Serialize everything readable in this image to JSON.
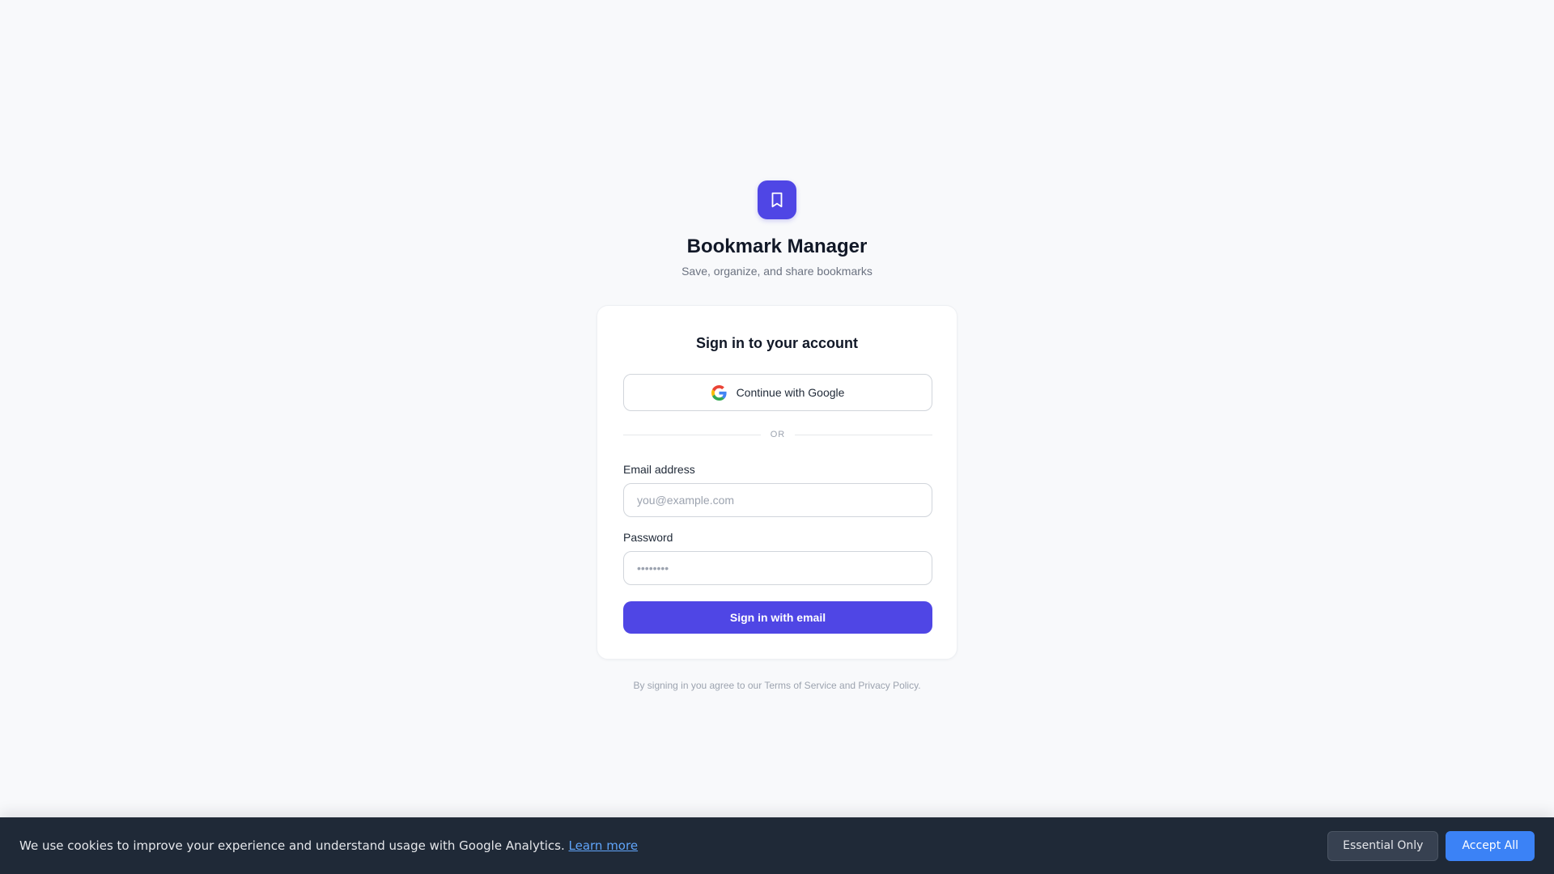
{
  "brand": {
    "logo_icon": "bookmark-icon",
    "accent_color": "#4f46e5",
    "title": "Bookmark Manager",
    "subtitle": "Save, organize, and share bookmarks"
  },
  "signin_card": {
    "title": "Sign in to your account",
    "google_button": {
      "label": "Continue with Google",
      "icon": "google-icon"
    },
    "divider_text": "OR",
    "email": {
      "label": "Email address",
      "placeholder": "you@example.com",
      "value": ""
    },
    "password": {
      "label": "Password",
      "placeholder": "••••••••",
      "value": ""
    },
    "submit_label": "Sign in with email"
  },
  "legal": {
    "prefix": "By signing in you agree to our ",
    "terms": "Terms of Service",
    "joiner": " and ",
    "privacy": "Privacy Policy",
    "suffix": "."
  },
  "cookie_banner": {
    "text": "We use cookies to improve your experience and understand usage with Google Analytics. ",
    "learn_more": "Learn more",
    "essential_label": "Essential Only",
    "accept_label": "Accept All",
    "background_color": "#1f2937",
    "accept_color": "#3b82f6"
  }
}
